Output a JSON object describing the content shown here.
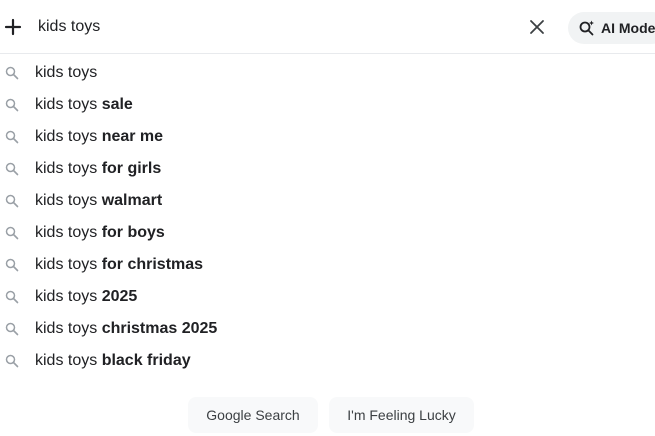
{
  "searchbar": {
    "query": "kids toys",
    "ai_mode_label": "AI Mode"
  },
  "icons": {
    "plus": "plus-icon",
    "clear": "close-icon",
    "ai_mode": "ai-search-sparkle-icon",
    "suggestion": "search-icon"
  },
  "suggestions": [
    {
      "prefix": "kids toys",
      "completion": ""
    },
    {
      "prefix": "kids toys ",
      "completion": "sale"
    },
    {
      "prefix": "kids toys ",
      "completion": "near me"
    },
    {
      "prefix": "kids toys ",
      "completion": "for girls"
    },
    {
      "prefix": "kids toys ",
      "completion": "walmart"
    },
    {
      "prefix": "kids toys ",
      "completion": "for boys"
    },
    {
      "prefix": "kids toys ",
      "completion": "for christmas"
    },
    {
      "prefix": "kids toys ",
      "completion": "2025"
    },
    {
      "prefix": "kids toys ",
      "completion": "christmas 2025"
    },
    {
      "prefix": "kids toys ",
      "completion": "black friday"
    }
  ],
  "buttons": {
    "search_label": "Google Search",
    "lucky_label": "I'm Feeling Lucky"
  },
  "colors": {
    "text": "#202124",
    "icon_gray": "#9aa0a6",
    "button_bg": "#f8f9fa",
    "pill_bg": "#f1f3f4"
  }
}
